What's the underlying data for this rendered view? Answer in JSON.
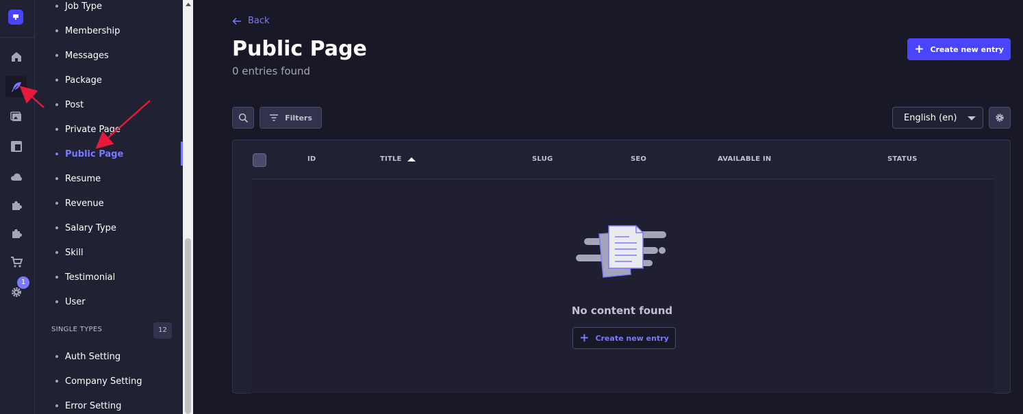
{
  "rail": {
    "icons": [
      "logo-icon",
      "home-icon",
      "content-manager-feather-icon",
      "media-library-icon",
      "content-type-builder-icon",
      "cloud-icon",
      "plugins-puzzle-icon",
      "marketplace-puzzle-icon",
      "cart-icon",
      "settings-gear-icon"
    ],
    "settings_badge": "1"
  },
  "sidebar": {
    "collection_items": [
      {
        "label": "Job Type"
      },
      {
        "label": "Membership"
      },
      {
        "label": "Messages"
      },
      {
        "label": "Package"
      },
      {
        "label": "Post"
      },
      {
        "label": "Private Page"
      },
      {
        "label": "Public Page"
      },
      {
        "label": "Resume"
      },
      {
        "label": "Revenue"
      },
      {
        "label": "Salary Type"
      },
      {
        "label": "Skill"
      },
      {
        "label": "Testimonial"
      },
      {
        "label": "User"
      }
    ],
    "single_types": {
      "label": "SINGLE TYPES",
      "count": "12",
      "items": [
        {
          "label": "Auth Setting"
        },
        {
          "label": "Company Setting"
        },
        {
          "label": "Error Setting"
        }
      ]
    },
    "active_item": "Public Page"
  },
  "header": {
    "back_label": "Back",
    "title": "Public Page",
    "subtitle": "0 entries found",
    "create_button": "Create new entry"
  },
  "toolbar": {
    "filters_label": "Filters",
    "locale_selected": "English (en)"
  },
  "table": {
    "columns": [
      {
        "label": "ID"
      },
      {
        "label": "TITLE"
      },
      {
        "label": "SLUG"
      },
      {
        "label": "SEO"
      },
      {
        "label": "AVAILABLE IN"
      },
      {
        "label": "STATUS"
      }
    ],
    "sorted_column": "TITLE",
    "sort_direction": "ascending"
  },
  "empty_state": {
    "message": "No content found",
    "button": "Create new entry"
  },
  "colors": {
    "accent": "#7b79ff",
    "primary_button": "#4945ff",
    "background": "#181826",
    "panel": "#212134",
    "annotation_arrow": "#e8193c"
  }
}
